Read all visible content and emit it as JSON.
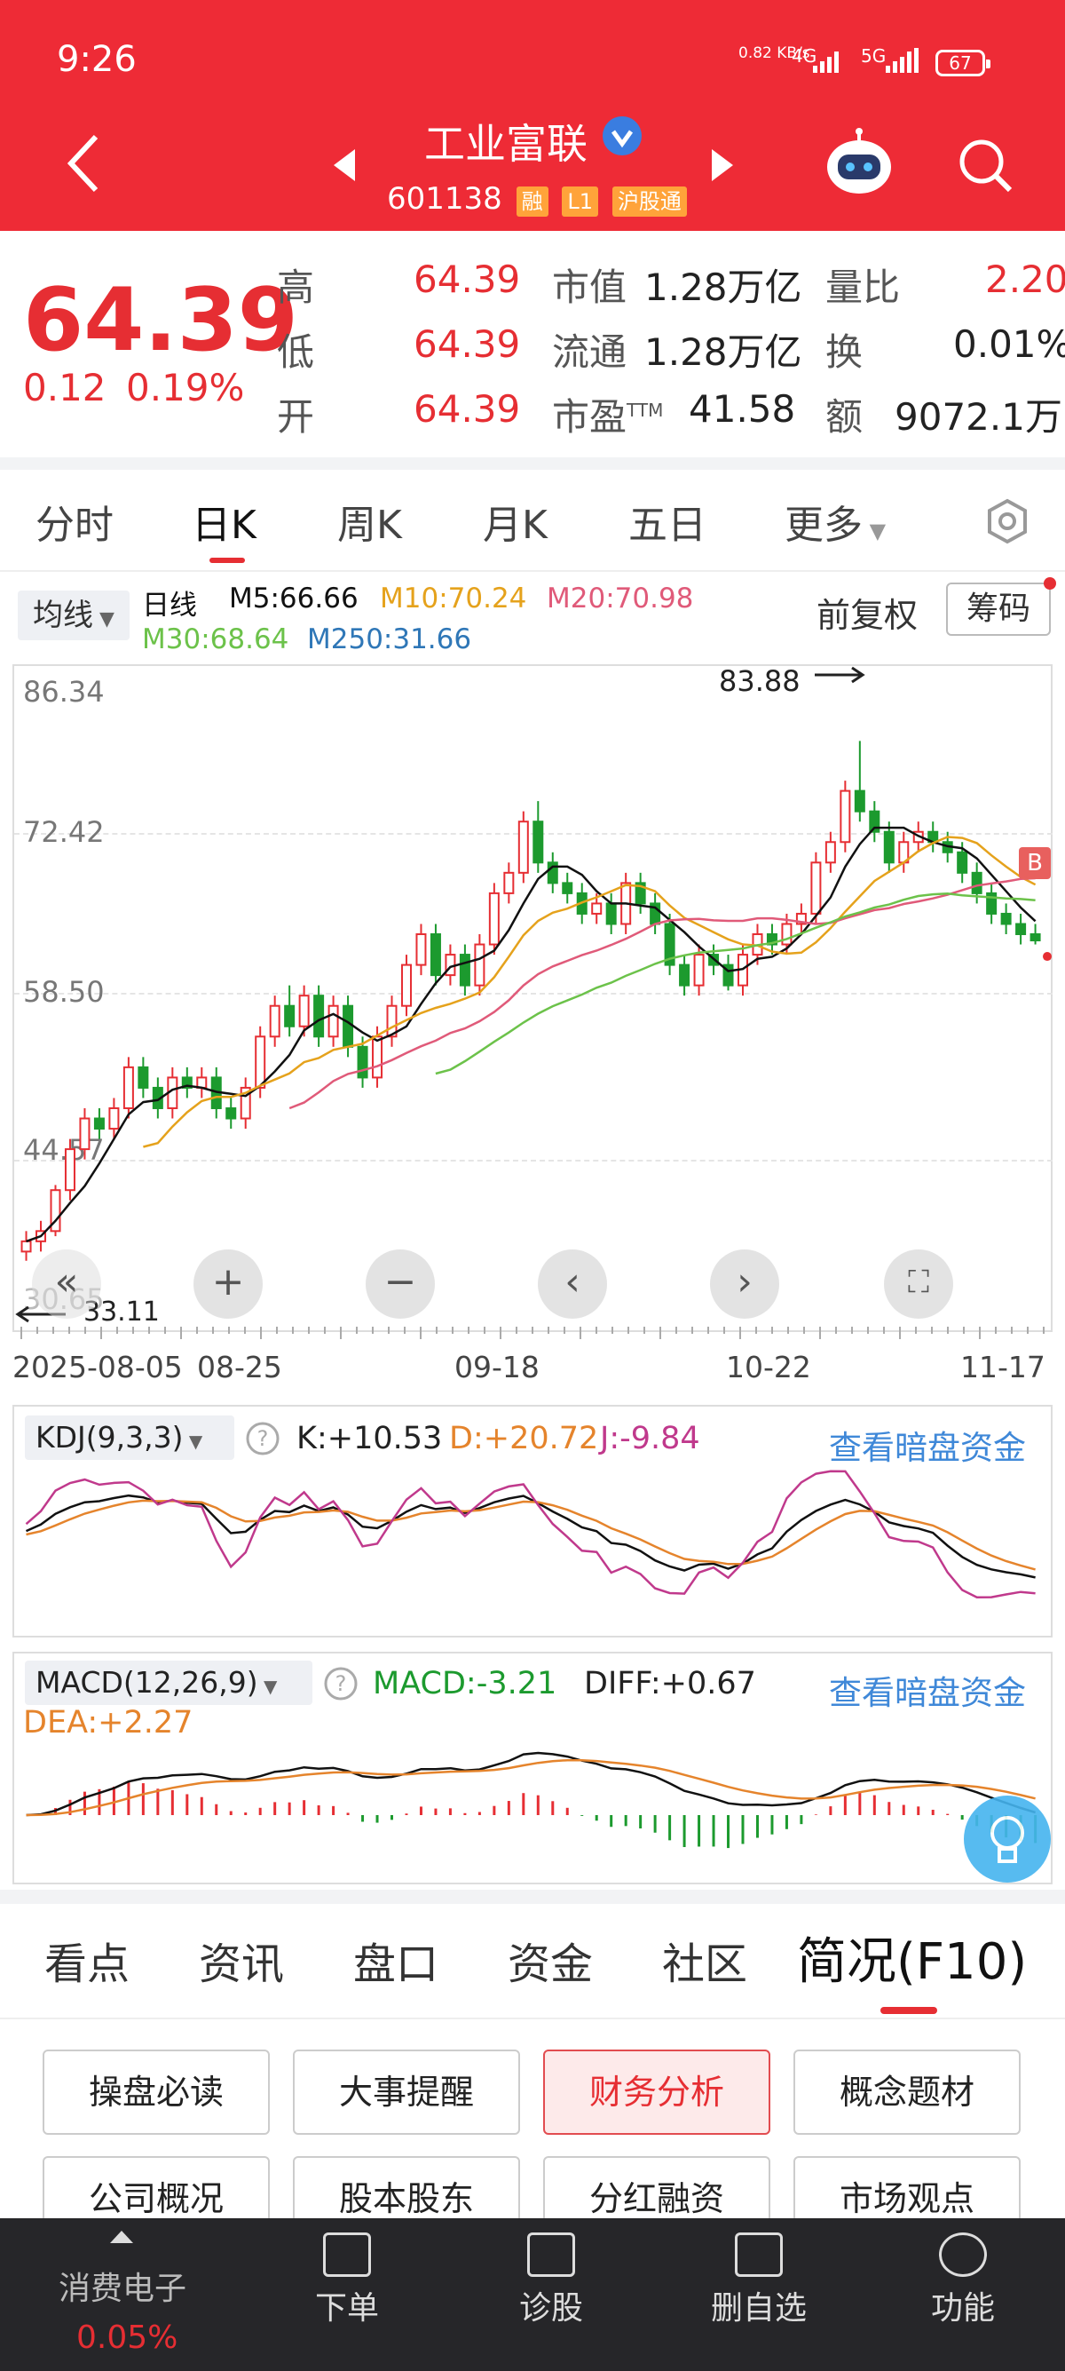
{
  "status_bar": {
    "time": "9:26",
    "speed": "0.82 KB/s",
    "net1": "4G",
    "net2": "5G",
    "battery": "67"
  },
  "header": {
    "name": "工业富联",
    "code": "601138",
    "badges": [
      "融",
      "L1",
      "沪股通"
    ]
  },
  "quote": {
    "price": "64.39",
    "change": "0.12",
    "change_pct": "0.19%",
    "high_label": "高",
    "high": "64.39",
    "low_label": "低",
    "low": "64.39",
    "open_label": "开",
    "open": "64.39",
    "mcap_label": "市值",
    "mcap": "1.28万亿",
    "float_label": "流通",
    "float": "1.28万亿",
    "pe_label": "市盈",
    "pe_sup": "TTM",
    "pe": "41.58",
    "vr_label": "量比",
    "vr": "2.20",
    "turn_label": "换",
    "turn": "0.01%",
    "amt_label": "额",
    "amt": "9072.1万"
  },
  "kline_tabs": [
    "分时",
    "日K",
    "周K",
    "月K",
    "五日",
    "更多"
  ],
  "active_kline_tab": "日K",
  "ma": {
    "selector": "均线",
    "period": "日线",
    "m5": "M5:66.66",
    "m10": "M10:70.24",
    "m20": "M20:70.98",
    "m30": "M30:68.64",
    "m250": "M250:31.66",
    "adjust": "前复权",
    "chips": "筹码"
  },
  "price_axis": [
    "86.34",
    "72.42",
    "58.50",
    "44.57",
    "30.65"
  ],
  "chart_annotations": {
    "high": "83.88",
    "low": "33.11",
    "flag": "B"
  },
  "date_axis": [
    "2025-08-05",
    "08-25",
    "09-18",
    "10-22",
    "11-17"
  ],
  "kdj": {
    "selector": "KDJ(9,3,3)",
    "k": "K:+10.53",
    "d": "D:+20.72",
    "j": "J:-9.84",
    "link": "查看暗盘资金"
  },
  "macd": {
    "selector": "MACD(12,26,9)",
    "macd": "MACD:-3.21",
    "diff": "DIFF:+0.67",
    "dea": "DEA:+2.27",
    "link": "查看暗盘资金"
  },
  "news_tabs": [
    "看点",
    "资讯",
    "盘口",
    "资金",
    "社区",
    "简况(F10)"
  ],
  "active_news_tab": "简况(F10)",
  "f10_buttons": [
    "操盘必读",
    "大事提醒",
    "财务分析",
    "概念题材",
    "公司概况",
    "股本股东",
    "分红融资",
    "市场观点"
  ],
  "active_f10": "财务分析",
  "bottom_nav": {
    "sector": "消费电子",
    "sector_change": "0.05%",
    "items": [
      "下单",
      "诊股",
      "删自选",
      "功能"
    ]
  },
  "colors": {
    "header": "#ee2b36",
    "up": "#e62e33",
    "down": "#1c9a2e",
    "m5": "#111111",
    "m10": "#e5a21c",
    "m20": "#e05a79",
    "m30": "#6cc24a",
    "m250": "#2f77b7"
  },
  "chart_data": {
    "type": "candlestick",
    "title": "工业富联 日K",
    "x": [
      "2025-08-05",
      "08-25",
      "09-18",
      "10-22",
      "11-17"
    ],
    "ylim": [
      30.65,
      86.34
    ],
    "y_ticks": [
      86.34,
      72.42,
      58.5,
      44.57,
      30.65
    ],
    "period_high": 83.88,
    "period_low": 33.11,
    "ma_last": {
      "M5": 66.66,
      "M10": 70.24,
      "M20": 70.98,
      "M30": 68.64,
      "M250": 31.66
    },
    "candles": [
      [
        34,
        35,
        33.1,
        36
      ],
      [
        35,
        36,
        34,
        37
      ],
      [
        36,
        40,
        35.5,
        40.5
      ],
      [
        40,
        44,
        39,
        45
      ],
      [
        44,
        47,
        43,
        48
      ],
      [
        47,
        46,
        45,
        48
      ],
      [
        46,
        48,
        45,
        49
      ],
      [
        48,
        52,
        47,
        53
      ],
      [
        52,
        50,
        49,
        53
      ],
      [
        50,
        48,
        47,
        51
      ],
      [
        48,
        51,
        47,
        52
      ],
      [
        51,
        50,
        49,
        52
      ],
      [
        50,
        51,
        49,
        52
      ],
      [
        51,
        48,
        47,
        52
      ],
      [
        48,
        47,
        46,
        49
      ],
      [
        47,
        50,
        46,
        51
      ],
      [
        50,
        55,
        49,
        56
      ],
      [
        55,
        58,
        54,
        59
      ],
      [
        58,
        56,
        55,
        60
      ],
      [
        56,
        59,
        55,
        60
      ],
      [
        59,
        55,
        54,
        60
      ],
      [
        55,
        58,
        54,
        59
      ],
      [
        58,
        54,
        53,
        59
      ],
      [
        54,
        51,
        50,
        55
      ],
      [
        51,
        55,
        50,
        56
      ],
      [
        55,
        58,
        54,
        59
      ],
      [
        58,
        62,
        57,
        63
      ],
      [
        62,
        65,
        61,
        66
      ],
      [
        65,
        61,
        60,
        66
      ],
      [
        61,
        63,
        60,
        64
      ],
      [
        63,
        60,
        59,
        64
      ],
      [
        60,
        64,
        59,
        65
      ],
      [
        64,
        69,
        63,
        70
      ],
      [
        69,
        71,
        68,
        72
      ],
      [
        71,
        76,
        70,
        77
      ],
      [
        76,
        72,
        71,
        78
      ],
      [
        72,
        70,
        69,
        73
      ],
      [
        70,
        69,
        68,
        71
      ],
      [
        69,
        67,
        66,
        70
      ],
      [
        67,
        68,
        66,
        69
      ],
      [
        68,
        66,
        65,
        69
      ],
      [
        66,
        70,
        65,
        71
      ],
      [
        70,
        68,
        67,
        71
      ],
      [
        68,
        66,
        65,
        69
      ],
      [
        66,
        62,
        61,
        67
      ],
      [
        62,
        60,
        59,
        63
      ],
      [
        60,
        63,
        59,
        64
      ],
      [
        63,
        62,
        61,
        64
      ],
      [
        62,
        60,
        59.5,
        63
      ],
      [
        60,
        63,
        59,
        64
      ],
      [
        63,
        65,
        62,
        66
      ],
      [
        65,
        64,
        63,
        66
      ],
      [
        64,
        66,
        63,
        67
      ],
      [
        66,
        67,
        65,
        68
      ],
      [
        67,
        72,
        66,
        73
      ],
      [
        72,
        74,
        71,
        75
      ],
      [
        74,
        79,
        73,
        80
      ],
      [
        79,
        77,
        76,
        83.88
      ],
      [
        77,
        75,
        74,
        78
      ],
      [
        75,
        72,
        71,
        76
      ],
      [
        72,
        74,
        71,
        75
      ],
      [
        74,
        75,
        73,
        76
      ],
      [
        75,
        74,
        73,
        76
      ],
      [
        74,
        73,
        72,
        75
      ],
      [
        73,
        71,
        70,
        74
      ],
      [
        71,
        69,
        68,
        72
      ],
      [
        69,
        67,
        66,
        70
      ],
      [
        67,
        66,
        65,
        68
      ],
      [
        66,
        65,
        64,
        67
      ],
      [
        65,
        64.39,
        64,
        66
      ]
    ],
    "kdj": {
      "K": 10.53,
      "D": 20.72,
      "J": -9.84
    },
    "macd": {
      "MACD": -3.21,
      "DIFF": 0.67,
      "DEA": 2.27
    }
  }
}
